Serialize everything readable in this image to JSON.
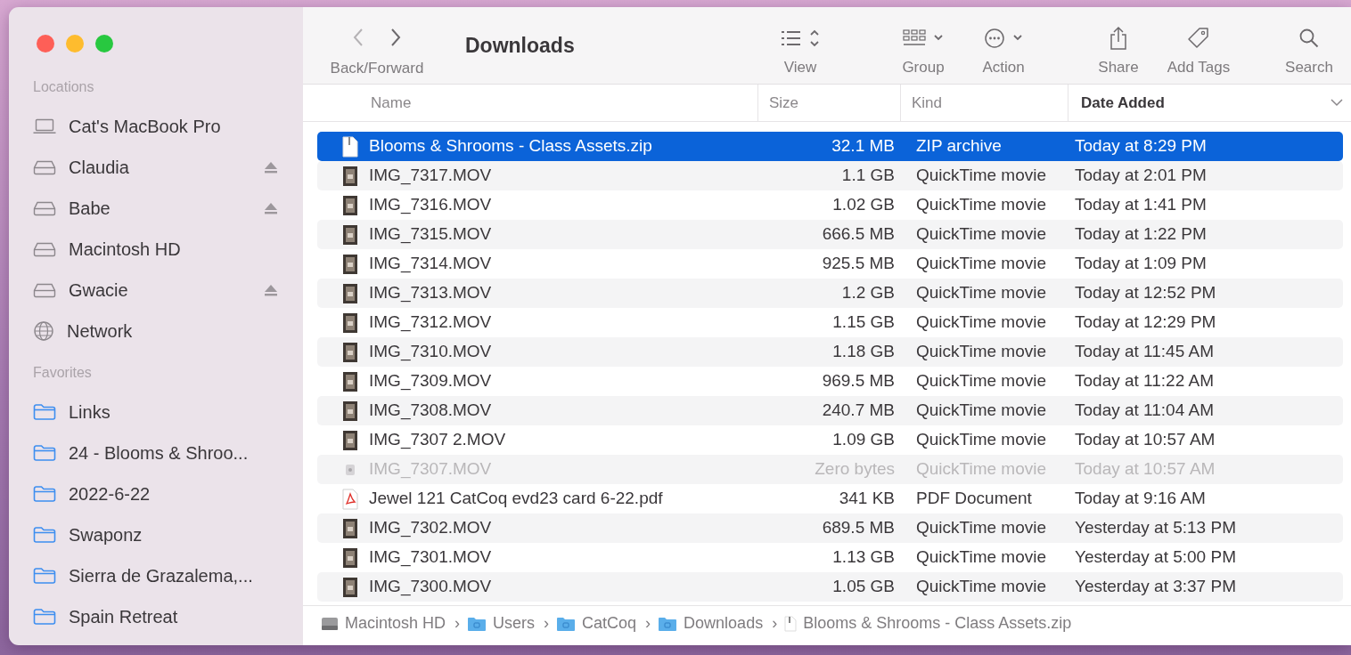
{
  "window": {
    "title": "Downloads"
  },
  "sidebar": {
    "sections": [
      {
        "title": "Locations",
        "items": [
          {
            "label": "Cat's MacBook Pro",
            "kind": "laptop",
            "ejectable": false
          },
          {
            "label": "Claudia",
            "kind": "drive",
            "ejectable": true
          },
          {
            "label": "Babe",
            "kind": "drive",
            "ejectable": true
          },
          {
            "label": "Macintosh HD",
            "kind": "drive",
            "ejectable": false
          },
          {
            "label": "Gwacie",
            "kind": "drive",
            "ejectable": true
          },
          {
            "label": "Network",
            "kind": "network",
            "ejectable": false
          }
        ]
      },
      {
        "title": "Favorites",
        "items": [
          {
            "label": "Links",
            "kind": "folder",
            "ejectable": false
          },
          {
            "label": "24 - Blooms & Shroo...",
            "kind": "folder",
            "ejectable": false
          },
          {
            "label": "2022-6-22",
            "kind": "folder",
            "ejectable": false
          },
          {
            "label": "Swaponz",
            "kind": "folder",
            "ejectable": false
          },
          {
            "label": "Sierra de Grazalema,...",
            "kind": "folder",
            "ejectable": false
          },
          {
            "label": "Spain Retreat",
            "kind": "folder",
            "ejectable": false
          }
        ]
      }
    ]
  },
  "toolbar": {
    "nav_label": "Back/Forward",
    "tools": [
      {
        "label": "View",
        "kind": "view"
      },
      {
        "label": "Group",
        "kind": "group"
      },
      {
        "label": "Action",
        "kind": "action"
      },
      {
        "label": "Share",
        "kind": "share"
      },
      {
        "label": "Add Tags",
        "kind": "tags"
      },
      {
        "label": "Search",
        "kind": "search"
      }
    ]
  },
  "table": {
    "columns": [
      {
        "label": "Name",
        "sorted": false
      },
      {
        "label": "Size",
        "sorted": false
      },
      {
        "label": "Kind",
        "sorted": false
      },
      {
        "label": "Date Added",
        "sorted": true
      }
    ],
    "rows": [
      {
        "name": "Blooms & Shrooms - Class Assets.zip",
        "size": "32.1 MB",
        "file_kind": "ZIP archive",
        "date": "Today at 8:29 PM",
        "kind": "zip",
        "selected": true,
        "dimmed": false
      },
      {
        "name": "IMG_7317.MOV",
        "size": "1.1 GB",
        "file_kind": "QuickTime movie",
        "date": "Today at 2:01 PM",
        "kind": "movie",
        "selected": false,
        "dimmed": false
      },
      {
        "name": "IMG_7316.MOV",
        "size": "1.02 GB",
        "file_kind": "QuickTime movie",
        "date": "Today at 1:41 PM",
        "kind": "movie",
        "selected": false,
        "dimmed": false
      },
      {
        "name": "IMG_7315.MOV",
        "size": "666.5 MB",
        "file_kind": "QuickTime movie",
        "date": "Today at 1:22 PM",
        "kind": "movie",
        "selected": false,
        "dimmed": false
      },
      {
        "name": "IMG_7314.MOV",
        "size": "925.5 MB",
        "file_kind": "QuickTime movie",
        "date": "Today at 1:09 PM",
        "kind": "movie",
        "selected": false,
        "dimmed": false
      },
      {
        "name": "IMG_7313.MOV",
        "size": "1.2 GB",
        "file_kind": "QuickTime movie",
        "date": "Today at 12:52 PM",
        "kind": "movie",
        "selected": false,
        "dimmed": false
      },
      {
        "name": "IMG_7312.MOV",
        "size": "1.15 GB",
        "file_kind": "QuickTime movie",
        "date": "Today at 12:29 PM",
        "kind": "movie",
        "selected": false,
        "dimmed": false
      },
      {
        "name": "IMG_7310.MOV",
        "size": "1.18 GB",
        "file_kind": "QuickTime movie",
        "date": "Today at 11:45 AM",
        "kind": "movie",
        "selected": false,
        "dimmed": false
      },
      {
        "name": "IMG_7309.MOV",
        "size": "969.5 MB",
        "file_kind": "QuickTime movie",
        "date": "Today at 11:22 AM",
        "kind": "movie",
        "selected": false,
        "dimmed": false
      },
      {
        "name": "IMG_7308.MOV",
        "size": "240.7 MB",
        "file_kind": "QuickTime movie",
        "date": "Today at 11:04 AM",
        "kind": "movie",
        "selected": false,
        "dimmed": false
      },
      {
        "name": "IMG_7307 2.MOV",
        "size": "1.09 GB",
        "file_kind": "QuickTime movie",
        "date": "Today at 10:57 AM",
        "kind": "movie",
        "selected": false,
        "dimmed": false
      },
      {
        "name": "IMG_7307.MOV",
        "size": "Zero bytes",
        "file_kind": "QuickTime movie",
        "date": "Today at 10:57 AM",
        "kind": "movie",
        "selected": false,
        "dimmed": true
      },
      {
        "name": "Jewel 121 CatCoq evd23 card 6-22.pdf",
        "size": "341 KB",
        "file_kind": "PDF Document",
        "date": "Today at 9:16 AM",
        "kind": "pdf",
        "selected": false,
        "dimmed": false
      },
      {
        "name": "IMG_7302.MOV",
        "size": "689.5 MB",
        "file_kind": "QuickTime movie",
        "date": "Yesterday at 5:13 PM",
        "kind": "movie",
        "selected": false,
        "dimmed": false
      },
      {
        "name": "IMG_7301.MOV",
        "size": "1.13 GB",
        "file_kind": "QuickTime movie",
        "date": "Yesterday at 5:00 PM",
        "kind": "movie",
        "selected": false,
        "dimmed": false
      },
      {
        "name": "IMG_7300.MOV",
        "size": "1.05 GB",
        "file_kind": "QuickTime movie",
        "date": "Yesterday at 3:37 PM",
        "kind": "movie",
        "selected": false,
        "dimmed": false
      }
    ]
  },
  "path_bar": {
    "items": [
      {
        "label": "Macintosh HD",
        "kind": "drive",
        "chevron": "›"
      },
      {
        "label": "Users",
        "kind": "folder",
        "chevron": "›"
      },
      {
        "label": "CatCoq",
        "kind": "folder",
        "chevron": "›"
      },
      {
        "label": "Downloads",
        "kind": "folder",
        "chevron": "›"
      },
      {
        "label": "Blooms & Shrooms - Class Assets.zip",
        "kind": "zip"
      }
    ]
  }
}
